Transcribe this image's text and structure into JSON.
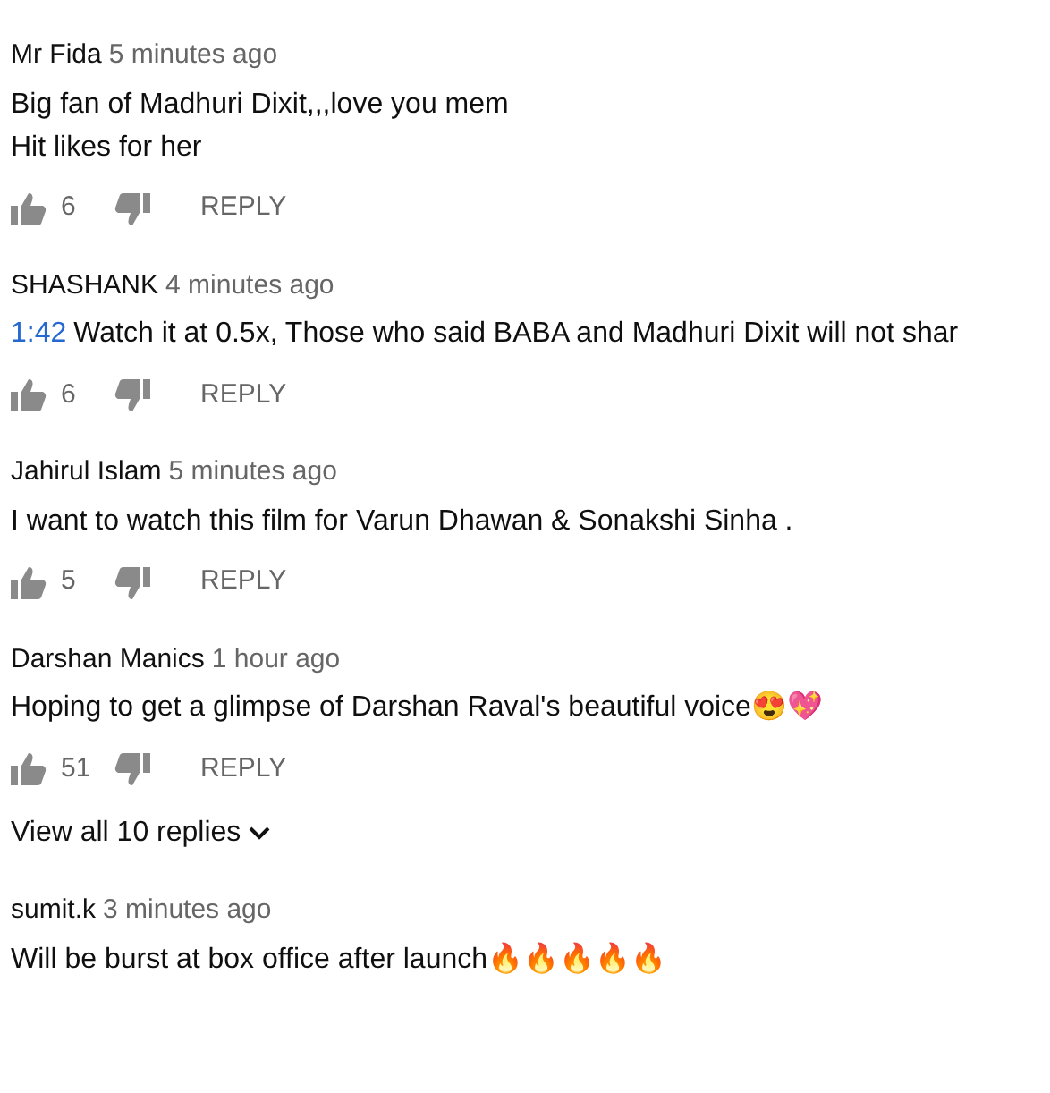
{
  "comments": [
    {
      "author": "Mr Fida",
      "time": "5 minutes ago",
      "lines": [
        "Big fan of Madhuri Dixit,,,love you mem",
        "Hit likes for her"
      ],
      "likes": "6",
      "reply": "REPLY"
    },
    {
      "author": "SHASHANK",
      "time": "4 minutes ago",
      "timestamp": "1:42",
      "lines": [
        "Watch it at 0.5x, Those who said BABA and Madhuri Dixit will not shar"
      ],
      "likes": "6",
      "reply": "REPLY"
    },
    {
      "author": "Jahirul Islam",
      "time": "5 minutes ago",
      "lines": [
        "I want to watch this film for Varun Dhawan & Sonakshi Sinha ."
      ],
      "likes": "5",
      "reply": "REPLY"
    },
    {
      "author": "Darshan Manics",
      "time": "1 hour ago",
      "lines": [
        "Hoping to get a glimpse of Darshan Raval's beautiful voice😍💖"
      ],
      "likes": "51",
      "reply": "REPLY",
      "replies_link": "View all 10 replies"
    },
    {
      "author": "sumit.k",
      "time": "3 minutes ago",
      "lines": [
        "Will be burst at box office after launch🔥🔥🔥🔥🔥"
      ]
    }
  ]
}
